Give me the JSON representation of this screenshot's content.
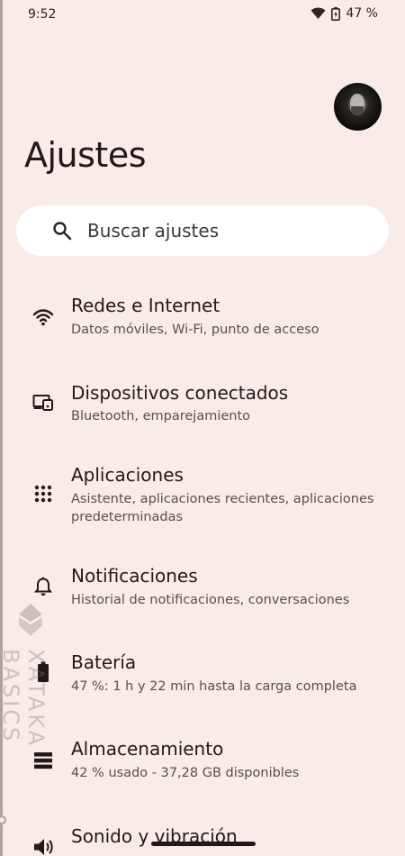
{
  "status_bar": {
    "time": "9:52",
    "battery": "47 %",
    "wifi_icon": "wifi-icon",
    "battery_icon": "battery-charging-icon"
  },
  "header": {
    "title": "Ajustes",
    "avatar": "avatar"
  },
  "search": {
    "placeholder": "Buscar ajustes",
    "icon": "search-icon"
  },
  "items": [
    {
      "title": "Redes e Internet",
      "subtitle": "Datos móviles, Wi-Fi, punto de acceso",
      "icon": "wifi-icon"
    },
    {
      "title": "Dispositivos conectados",
      "subtitle": "Bluetooth, emparejamiento",
      "icon": "devices-icon"
    },
    {
      "title": "Aplicaciones",
      "subtitle": "Asistente, aplicaciones recientes, aplicaciones predeterminadas",
      "icon": "apps-grid-icon"
    },
    {
      "title": "Notificaciones",
      "subtitle": "Historial de notificaciones, conversaciones",
      "icon": "bell-icon"
    },
    {
      "title": "Batería",
      "subtitle": "47 %: 1 h y 22 min hasta la carga completa",
      "icon": "battery-icon"
    },
    {
      "title": "Almacenamiento",
      "subtitle": "42 % usado - 37,28 GB disponibles",
      "icon": "storage-icon"
    },
    {
      "title": "Sonido y vibración",
      "subtitle": "",
      "icon": "volume-icon"
    }
  ],
  "watermark": {
    "text": "XATAKA BASICS"
  },
  "colors": {
    "background": "#f9ebe7",
    "search_background": "#ffffff",
    "primary_text": "#1f1a19",
    "secondary_text": "#57504e"
  }
}
